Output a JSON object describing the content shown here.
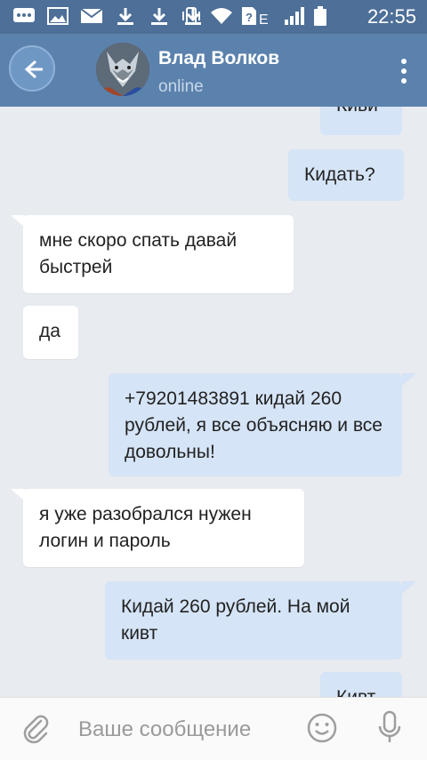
{
  "status_bar": {
    "time": "22:55",
    "network_label": "E"
  },
  "header": {
    "contact_name": "Влад Волков",
    "contact_status": "online"
  },
  "messages": [
    {
      "direction": "out",
      "text": "Киви",
      "partial": true
    },
    {
      "direction": "out",
      "text": "Кидать?"
    },
    {
      "direction": "in",
      "text": "мне скоро спать давай быстрей"
    },
    {
      "direction": "in",
      "text": "да"
    },
    {
      "direction": "out",
      "text": "+79201483891 кидай 260 рублей, я все объясняю и все довольны!"
    },
    {
      "direction": "in",
      "text": "я уже разобрался нужен логин и пароль"
    },
    {
      "direction": "out",
      "text": "Кидай 260 рублей. На мой кивт"
    },
    {
      "direction": "out",
      "text": "Кивт",
      "partial": true
    }
  ],
  "input": {
    "placeholder": "Ваше сообщение"
  },
  "colors": {
    "status_bar": "#4d6f98",
    "app_bar": "#5b82ad",
    "chat_bg": "#e8ebf0",
    "outgoing_bubble": "#d5e4f6",
    "incoming_bubble": "#ffffff"
  },
  "icons": {
    "status_left": [
      "chat-icon",
      "image-icon",
      "mail-icon",
      "download-icon",
      "download-icon",
      "download-icon"
    ],
    "status_right": [
      "vibrate-icon",
      "wifi-icon",
      "sim-icon",
      "signal-icon",
      "battery-icon"
    ],
    "header": [
      "back-icon",
      "more-vert-icon"
    ],
    "input": [
      "attach-icon",
      "emoji-icon",
      "mic-icon"
    ]
  }
}
